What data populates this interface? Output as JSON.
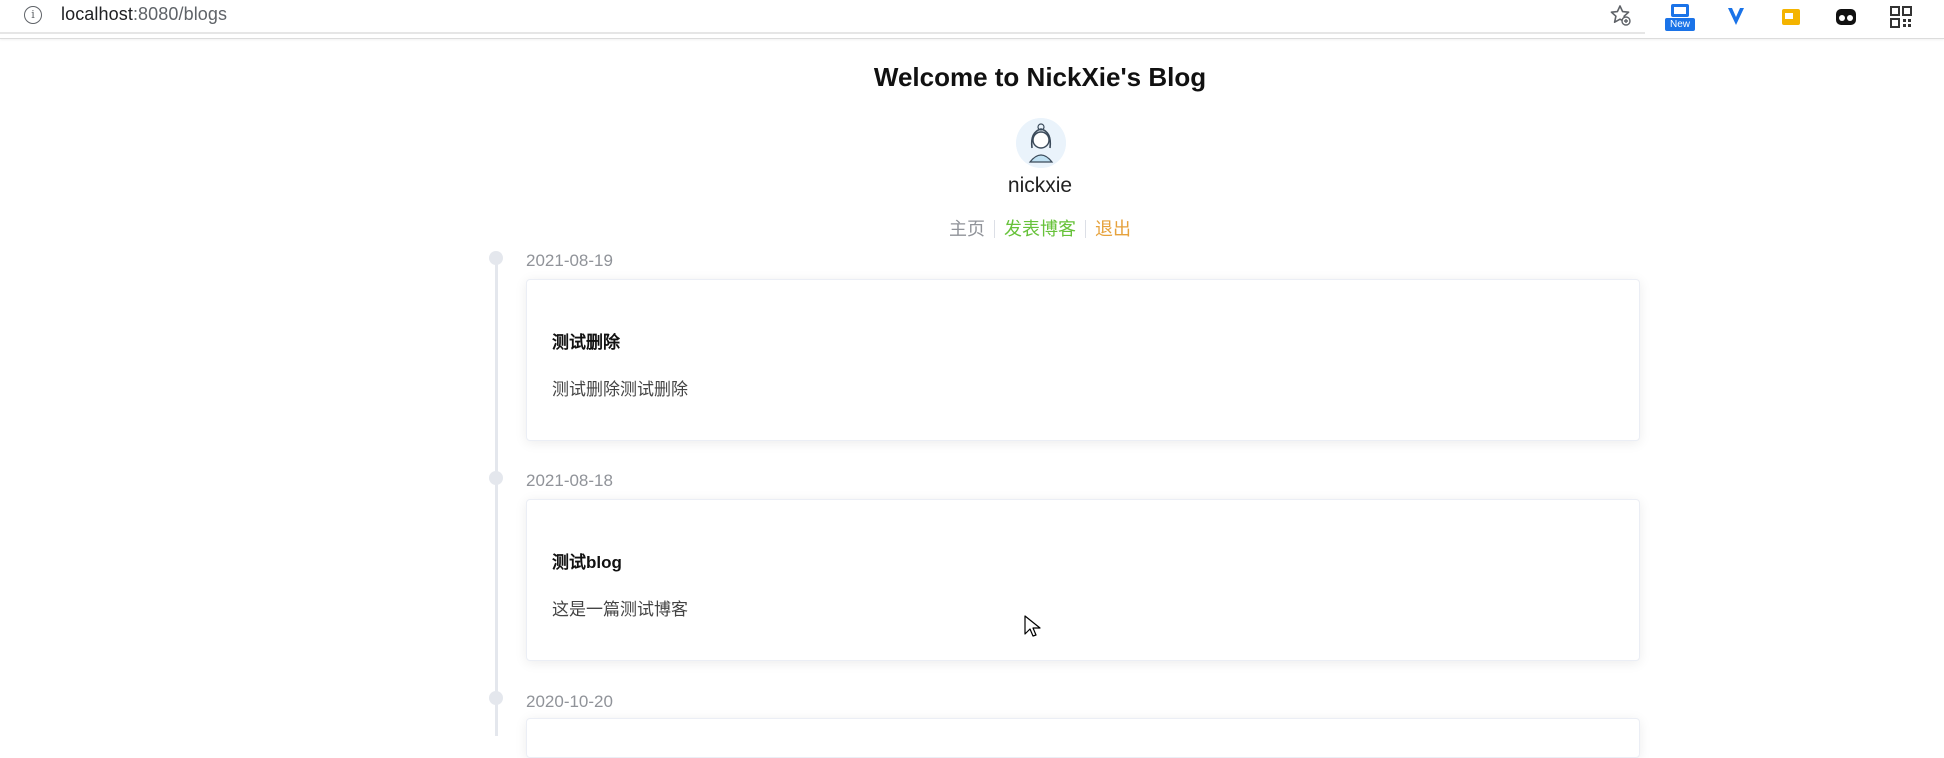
{
  "browser": {
    "url_host": "localhost",
    "url_rest": ":8080/blogs",
    "ext_badge": "New"
  },
  "page": {
    "title": "Welcome to NickXie's Blog",
    "username": "nickxie"
  },
  "nav": {
    "home": "主页",
    "publish": "发表博客",
    "logout": "退出"
  },
  "blogs": [
    {
      "date": "2021-08-19",
      "title": "测试删除",
      "description": "测试删除测试删除"
    },
    {
      "date": "2021-08-18",
      "title": "测试blog",
      "description": "这是一篇测试博客"
    },
    {
      "date": "2020-10-20"
    }
  ],
  "colors": {
    "publish": "#67c23a",
    "logout": "#e6a23c",
    "home": "#909399"
  }
}
